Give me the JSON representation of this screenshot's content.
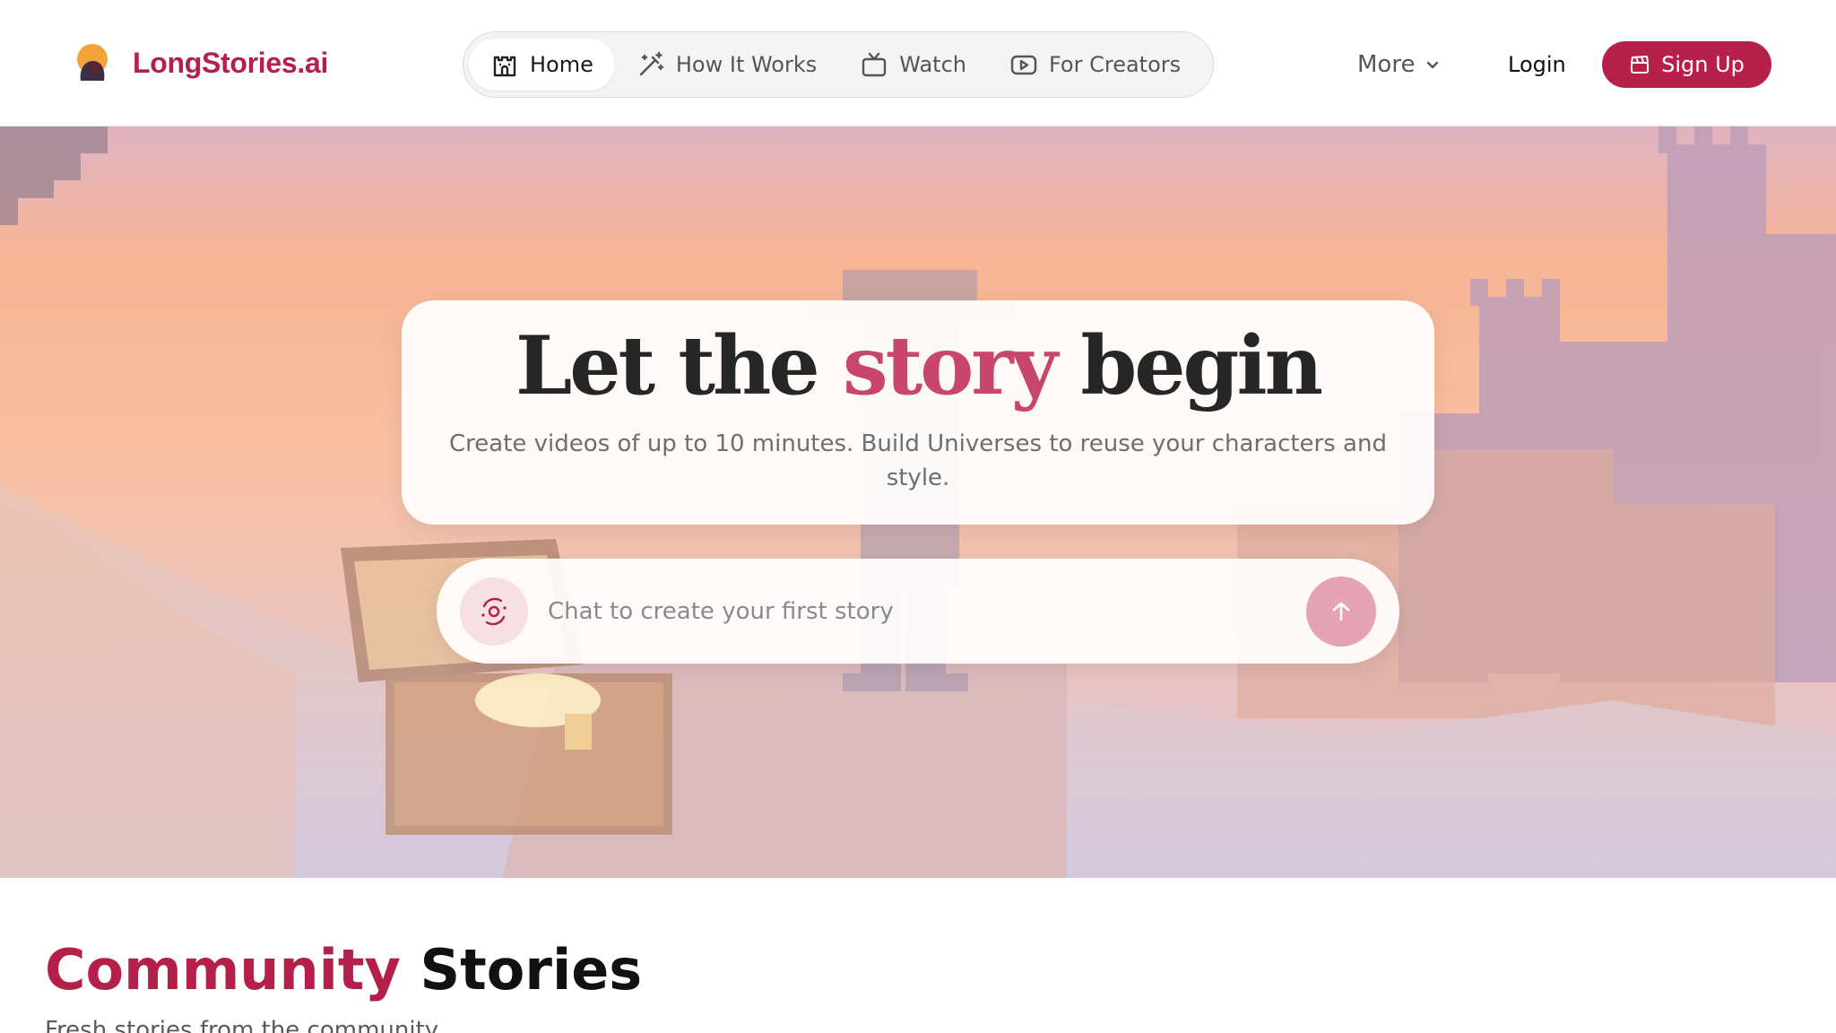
{
  "header": {
    "brand": "LongStories.ai",
    "nav": [
      {
        "label": "Home",
        "icon": "castle-icon",
        "active": true
      },
      {
        "label": "How It Works",
        "icon": "magic-wand-icon",
        "active": false
      },
      {
        "label": "Watch",
        "icon": "tv-icon",
        "active": false
      },
      {
        "label": "For Creators",
        "icon": "play-square-icon",
        "active": false
      }
    ],
    "more_label": "More",
    "login_label": "Login",
    "signup_label": "Sign Up"
  },
  "hero": {
    "title_before": "Let the ",
    "title_accent": "story",
    "title_after": " begin",
    "subtitle": "Create videos of up to 10 minutes. Build Universes to reuse your characters and style.",
    "chat_placeholder": "Chat to create your first story"
  },
  "community": {
    "title_accent": "Community",
    "title_rest": " Stories",
    "subtitle": "Fresh stories from the community"
  },
  "colors": {
    "brand": "#b5204a",
    "accent_pink": "#c8456b",
    "send_button": "#e7a3b6"
  }
}
